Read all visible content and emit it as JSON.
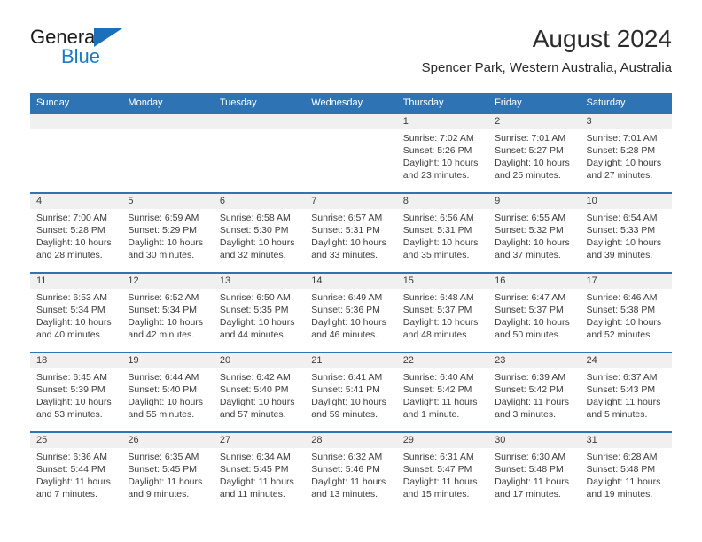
{
  "brand": {
    "name_top": "General",
    "name_bottom": "Blue",
    "triangle_color": "#1c6fba",
    "bottom_color": "#1f7ac4"
  },
  "header": {
    "title": "August 2024",
    "subtitle": "Spencer Park, Western Australia, Australia"
  },
  "colors": {
    "header_blue": "#2e74b5",
    "daynum_band": "#f0f0f0",
    "text": "#3c3c3c"
  },
  "weekdays": [
    "Sunday",
    "Monday",
    "Tuesday",
    "Wednesday",
    "Thursday",
    "Friday",
    "Saturday"
  ],
  "weeks": [
    {
      "days": [
        {
          "num": "",
          "sunrise": "",
          "sunset": "",
          "daylight1": "",
          "daylight2": ""
        },
        {
          "num": "",
          "sunrise": "",
          "sunset": "",
          "daylight1": "",
          "daylight2": ""
        },
        {
          "num": "",
          "sunrise": "",
          "sunset": "",
          "daylight1": "",
          "daylight2": ""
        },
        {
          "num": "",
          "sunrise": "",
          "sunset": "",
          "daylight1": "",
          "daylight2": ""
        },
        {
          "num": "1",
          "sunrise": "Sunrise: 7:02 AM",
          "sunset": "Sunset: 5:26 PM",
          "daylight1": "Daylight: 10 hours",
          "daylight2": "and 23 minutes."
        },
        {
          "num": "2",
          "sunrise": "Sunrise: 7:01 AM",
          "sunset": "Sunset: 5:27 PM",
          "daylight1": "Daylight: 10 hours",
          "daylight2": "and 25 minutes."
        },
        {
          "num": "3",
          "sunrise": "Sunrise: 7:01 AM",
          "sunset": "Sunset: 5:28 PM",
          "daylight1": "Daylight: 10 hours",
          "daylight2": "and 27 minutes."
        }
      ]
    },
    {
      "days": [
        {
          "num": "4",
          "sunrise": "Sunrise: 7:00 AM",
          "sunset": "Sunset: 5:28 PM",
          "daylight1": "Daylight: 10 hours",
          "daylight2": "and 28 minutes."
        },
        {
          "num": "5",
          "sunrise": "Sunrise: 6:59 AM",
          "sunset": "Sunset: 5:29 PM",
          "daylight1": "Daylight: 10 hours",
          "daylight2": "and 30 minutes."
        },
        {
          "num": "6",
          "sunrise": "Sunrise: 6:58 AM",
          "sunset": "Sunset: 5:30 PM",
          "daylight1": "Daylight: 10 hours",
          "daylight2": "and 32 minutes."
        },
        {
          "num": "7",
          "sunrise": "Sunrise: 6:57 AM",
          "sunset": "Sunset: 5:31 PM",
          "daylight1": "Daylight: 10 hours",
          "daylight2": "and 33 minutes."
        },
        {
          "num": "8",
          "sunrise": "Sunrise: 6:56 AM",
          "sunset": "Sunset: 5:31 PM",
          "daylight1": "Daylight: 10 hours",
          "daylight2": "and 35 minutes."
        },
        {
          "num": "9",
          "sunrise": "Sunrise: 6:55 AM",
          "sunset": "Sunset: 5:32 PM",
          "daylight1": "Daylight: 10 hours",
          "daylight2": "and 37 minutes."
        },
        {
          "num": "10",
          "sunrise": "Sunrise: 6:54 AM",
          "sunset": "Sunset: 5:33 PM",
          "daylight1": "Daylight: 10 hours",
          "daylight2": "and 39 minutes."
        }
      ]
    },
    {
      "days": [
        {
          "num": "11",
          "sunrise": "Sunrise: 6:53 AM",
          "sunset": "Sunset: 5:34 PM",
          "daylight1": "Daylight: 10 hours",
          "daylight2": "and 40 minutes."
        },
        {
          "num": "12",
          "sunrise": "Sunrise: 6:52 AM",
          "sunset": "Sunset: 5:34 PM",
          "daylight1": "Daylight: 10 hours",
          "daylight2": "and 42 minutes."
        },
        {
          "num": "13",
          "sunrise": "Sunrise: 6:50 AM",
          "sunset": "Sunset: 5:35 PM",
          "daylight1": "Daylight: 10 hours",
          "daylight2": "and 44 minutes."
        },
        {
          "num": "14",
          "sunrise": "Sunrise: 6:49 AM",
          "sunset": "Sunset: 5:36 PM",
          "daylight1": "Daylight: 10 hours",
          "daylight2": "and 46 minutes."
        },
        {
          "num": "15",
          "sunrise": "Sunrise: 6:48 AM",
          "sunset": "Sunset: 5:37 PM",
          "daylight1": "Daylight: 10 hours",
          "daylight2": "and 48 minutes."
        },
        {
          "num": "16",
          "sunrise": "Sunrise: 6:47 AM",
          "sunset": "Sunset: 5:37 PM",
          "daylight1": "Daylight: 10 hours",
          "daylight2": "and 50 minutes."
        },
        {
          "num": "17",
          "sunrise": "Sunrise: 6:46 AM",
          "sunset": "Sunset: 5:38 PM",
          "daylight1": "Daylight: 10 hours",
          "daylight2": "and 52 minutes."
        }
      ]
    },
    {
      "days": [
        {
          "num": "18",
          "sunrise": "Sunrise: 6:45 AM",
          "sunset": "Sunset: 5:39 PM",
          "daylight1": "Daylight: 10 hours",
          "daylight2": "and 53 minutes."
        },
        {
          "num": "19",
          "sunrise": "Sunrise: 6:44 AM",
          "sunset": "Sunset: 5:40 PM",
          "daylight1": "Daylight: 10 hours",
          "daylight2": "and 55 minutes."
        },
        {
          "num": "20",
          "sunrise": "Sunrise: 6:42 AM",
          "sunset": "Sunset: 5:40 PM",
          "daylight1": "Daylight: 10 hours",
          "daylight2": "and 57 minutes."
        },
        {
          "num": "21",
          "sunrise": "Sunrise: 6:41 AM",
          "sunset": "Sunset: 5:41 PM",
          "daylight1": "Daylight: 10 hours",
          "daylight2": "and 59 minutes."
        },
        {
          "num": "22",
          "sunrise": "Sunrise: 6:40 AM",
          "sunset": "Sunset: 5:42 PM",
          "daylight1": "Daylight: 11 hours",
          "daylight2": "and 1 minute."
        },
        {
          "num": "23",
          "sunrise": "Sunrise: 6:39 AM",
          "sunset": "Sunset: 5:42 PM",
          "daylight1": "Daylight: 11 hours",
          "daylight2": "and 3 minutes."
        },
        {
          "num": "24",
          "sunrise": "Sunrise: 6:37 AM",
          "sunset": "Sunset: 5:43 PM",
          "daylight1": "Daylight: 11 hours",
          "daylight2": "and 5 minutes."
        }
      ]
    },
    {
      "days": [
        {
          "num": "25",
          "sunrise": "Sunrise: 6:36 AM",
          "sunset": "Sunset: 5:44 PM",
          "daylight1": "Daylight: 11 hours",
          "daylight2": "and 7 minutes."
        },
        {
          "num": "26",
          "sunrise": "Sunrise: 6:35 AM",
          "sunset": "Sunset: 5:45 PM",
          "daylight1": "Daylight: 11 hours",
          "daylight2": "and 9 minutes."
        },
        {
          "num": "27",
          "sunrise": "Sunrise: 6:34 AM",
          "sunset": "Sunset: 5:45 PM",
          "daylight1": "Daylight: 11 hours",
          "daylight2": "and 11 minutes."
        },
        {
          "num": "28",
          "sunrise": "Sunrise: 6:32 AM",
          "sunset": "Sunset: 5:46 PM",
          "daylight1": "Daylight: 11 hours",
          "daylight2": "and 13 minutes."
        },
        {
          "num": "29",
          "sunrise": "Sunrise: 6:31 AM",
          "sunset": "Sunset: 5:47 PM",
          "daylight1": "Daylight: 11 hours",
          "daylight2": "and 15 minutes."
        },
        {
          "num": "30",
          "sunrise": "Sunrise: 6:30 AM",
          "sunset": "Sunset: 5:48 PM",
          "daylight1": "Daylight: 11 hours",
          "daylight2": "and 17 minutes."
        },
        {
          "num": "31",
          "sunrise": "Sunrise: 6:28 AM",
          "sunset": "Sunset: 5:48 PM",
          "daylight1": "Daylight: 11 hours",
          "daylight2": "and 19 minutes."
        }
      ]
    }
  ]
}
